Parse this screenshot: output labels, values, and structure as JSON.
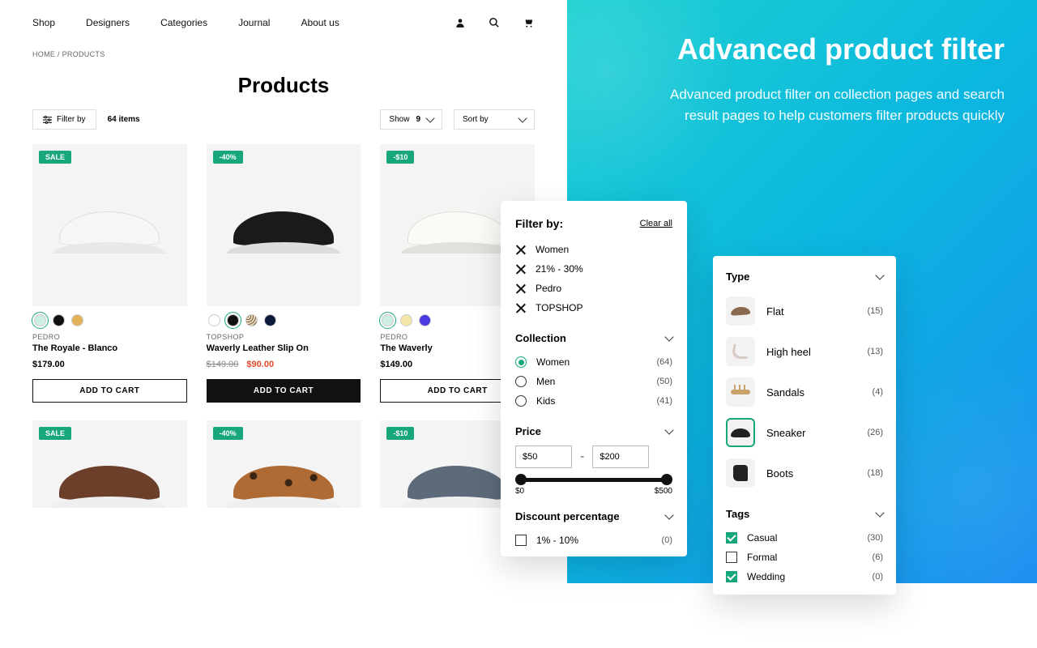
{
  "nav": {
    "items": [
      "Shop",
      "Designers",
      "Categories",
      "Journal",
      "About us"
    ]
  },
  "breadcrumb": "HOME / PRODUCTS",
  "title": "Products",
  "toolbar": {
    "filter_by": "Filter by",
    "count": "64 items",
    "show": "Show",
    "show_val": "9",
    "sort": "Sort by"
  },
  "badges": {
    "sale": "SALE",
    "p40": "-40%",
    "p10": "-$10"
  },
  "cards": [
    {
      "vendor": "PEDRO",
      "name": "The Royale - Blanco",
      "price": "$179.00",
      "btn": "ADD TO CART"
    },
    {
      "vendor": "TOPSHOP",
      "name": "Waverly Leather Slip On",
      "price_old": "$149.00",
      "price_sale": "$90.00",
      "btn": "ADD TO CART"
    },
    {
      "vendor": "PEDRO",
      "name": "The Waverly",
      "price": "$149.00",
      "btn": "ADD TO CART"
    }
  ],
  "promo": {
    "title": "Advanced product filter",
    "body": "Advanced product filter on collection pages and search result pages to help customers filter products quickly"
  },
  "filter_panel": {
    "heading": "Filter by:",
    "clear": "Clear all",
    "active": [
      "Women",
      "21% - 30%",
      "Pedro",
      "TOPSHOP"
    ],
    "collection": {
      "label": "Collection",
      "items": [
        {
          "l": "Women",
          "c": "(64)",
          "sel": true
        },
        {
          "l": "Men",
          "c": "(50)"
        },
        {
          "l": "Kids",
          "c": "(41)"
        }
      ]
    },
    "price": {
      "label": "Price",
      "min": "$50",
      "max": "$200",
      "lo": "$0",
      "hi": "$500"
    },
    "discount": {
      "label": "Discount percentage",
      "items": [
        {
          "l": "1% - 10%",
          "c": "(0)"
        }
      ]
    }
  },
  "type_panel": {
    "heading": "Type",
    "items": [
      {
        "l": "Flat",
        "c": "(15)"
      },
      {
        "l": "High heel",
        "c": "(13)"
      },
      {
        "l": "Sandals",
        "c": "(4)"
      },
      {
        "l": "Sneaker",
        "c": "(26)",
        "sel": true
      },
      {
        "l": "Boots",
        "c": "(18)"
      }
    ],
    "tags": {
      "label": "Tags",
      "items": [
        {
          "l": "Casual",
          "c": "(30)",
          "on": true
        },
        {
          "l": "Formal",
          "c": "(6)"
        },
        {
          "l": "Wedding",
          "c": "(0)",
          "on": true
        }
      ]
    }
  }
}
